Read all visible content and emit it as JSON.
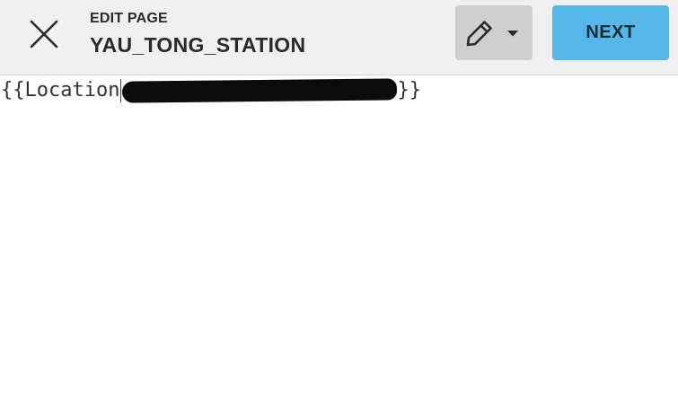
{
  "header": {
    "kicker": "EDIT PAGE",
    "page_title": "YAU_TONG_STATION",
    "close_icon": "close-icon",
    "tool_icon": "pencil-icon",
    "tool_menu_icon": "caret-down-icon",
    "next_label": "NEXT"
  },
  "editor": {
    "text_before": "{{Location",
    "text_after": "}}",
    "redacted": true
  },
  "colors": {
    "toolbar_bg": "#f0f0f0",
    "tool_button_bg": "#cfcfcf",
    "next_button_bg": "#55b6e9",
    "text": "#2a2a2a"
  }
}
